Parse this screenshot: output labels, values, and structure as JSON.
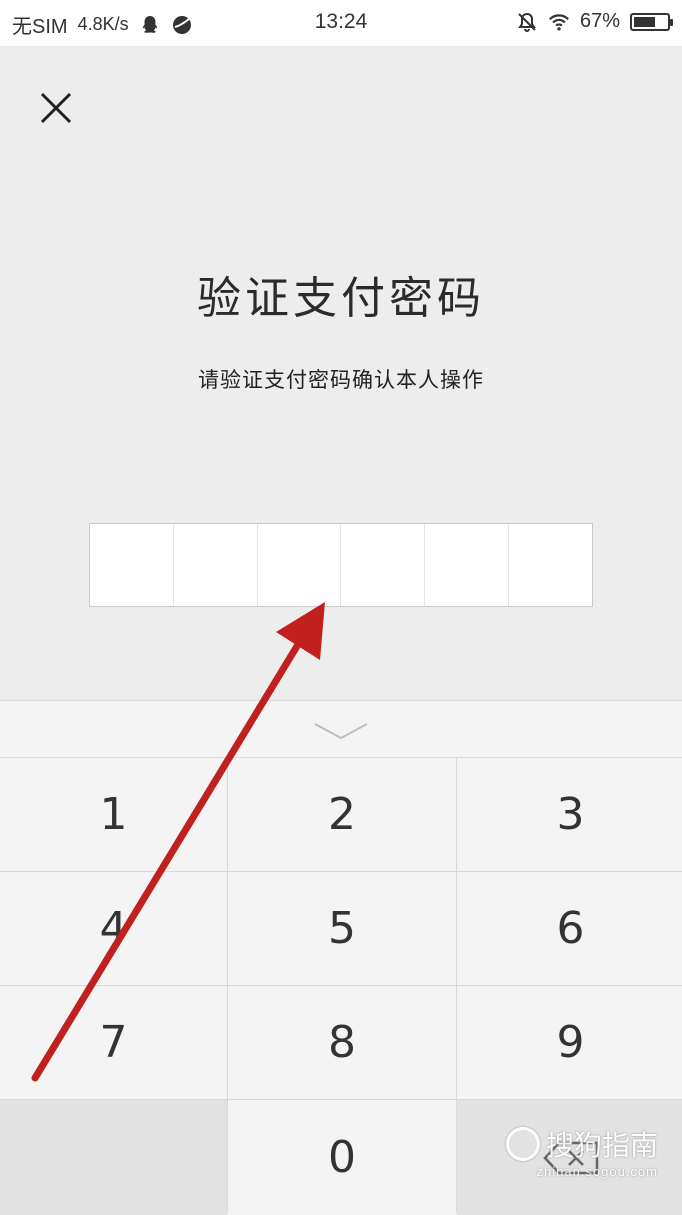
{
  "status_bar": {
    "carrier": "无SIM",
    "net_speed": "4.8K/s",
    "time": "13:24",
    "battery": "67%",
    "battery_level": 0.67,
    "icons": [
      "qq-icon",
      "browser-icon",
      "mute-icon",
      "wifi-icon",
      "battery-icon"
    ]
  },
  "dialog": {
    "title": "验证支付密码",
    "subtitle": "请验证支付密码确认本人操作",
    "password_length": 6,
    "password_digits": [
      "",
      "",
      "",
      "",
      "",
      ""
    ]
  },
  "keypad": {
    "keys": [
      "1",
      "2",
      "3",
      "4",
      "5",
      "6",
      "7",
      "8",
      "9",
      "",
      "0",
      "delete"
    ]
  },
  "watermark": {
    "brand": "搜狗指南",
    "url": "zhinan.sogou.com"
  },
  "colors": {
    "arrow": "#c0201e",
    "background": "#ededed",
    "key_bg": "#f4f4f4"
  }
}
